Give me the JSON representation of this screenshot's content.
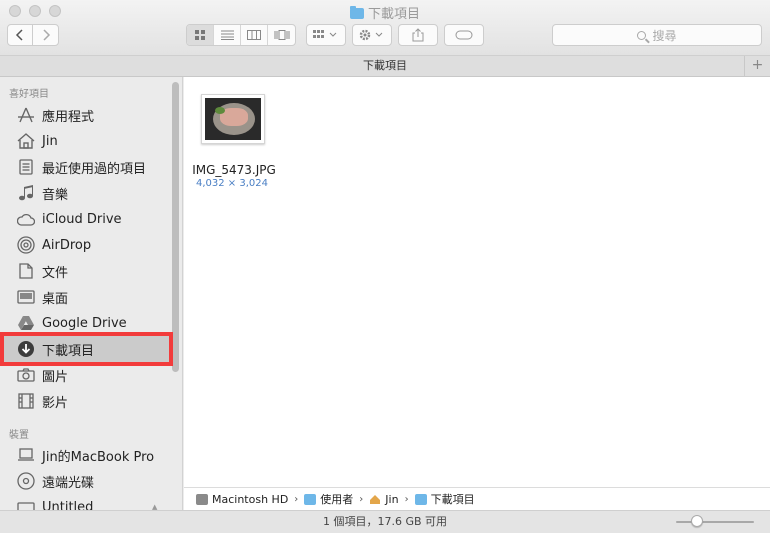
{
  "window": {
    "title": "下載項目"
  },
  "toolbar": {
    "back_icon": "chevron-left-icon",
    "forward_icon": "chevron-right-icon",
    "search_placeholder": "搜尋"
  },
  "tab": {
    "label": "下載項目"
  },
  "sidebar": {
    "favorites_header": "喜好項目",
    "favorites": [
      {
        "label": "應用程式",
        "icon": "applications-icon"
      },
      {
        "label": "Jin",
        "icon": "home-icon"
      },
      {
        "label": "最近使用過的項目",
        "icon": "recents-icon"
      },
      {
        "label": "音樂",
        "icon": "music-icon"
      },
      {
        "label": "iCloud Drive",
        "icon": "cloud-icon"
      },
      {
        "label": "AirDrop",
        "icon": "airdrop-icon"
      },
      {
        "label": "文件",
        "icon": "document-icon"
      },
      {
        "label": "桌面",
        "icon": "desktop-icon"
      },
      {
        "label": "Google Drive",
        "icon": "google-drive-icon"
      },
      {
        "label": "下載項目",
        "icon": "download-icon",
        "selected": true
      },
      {
        "label": "圖片",
        "icon": "camera-icon"
      },
      {
        "label": "影片",
        "icon": "film-icon"
      }
    ],
    "devices_header": "裝置",
    "devices": [
      {
        "label": "Jin的MacBook Pro",
        "icon": "laptop-icon"
      },
      {
        "label": "遠端光碟",
        "icon": "disc-icon"
      },
      {
        "label": "Untitled",
        "icon": "drive-icon"
      }
    ]
  },
  "content": {
    "files": [
      {
        "name": "IMG_5473.JPG",
        "dimensions": "4,032 × 3,024"
      }
    ]
  },
  "pathbar": {
    "crumbs": [
      "Macintosh HD",
      "使用者",
      "Jin",
      "下載項目"
    ]
  },
  "status": {
    "text": "1 個項目，17.6 GB 可用"
  },
  "colors": {
    "accent": "#4a7fc4",
    "highlight": "#f23b3b",
    "folder": "#6eb7e8"
  }
}
